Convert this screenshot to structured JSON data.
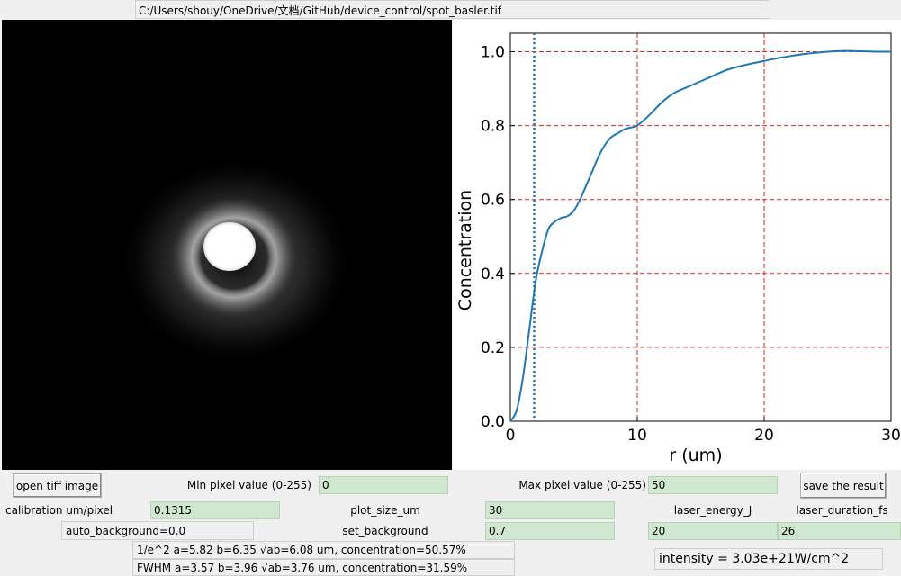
{
  "file_path": "C:/Users/shouy/OneDrive/文档/GitHub/device_control/spot_basler.tif",
  "controls": {
    "open_button": "open tiff image",
    "min_pixel_label": "Min pixel value (0-255)",
    "min_pixel_value": "0",
    "max_pixel_label": "Max pixel value (0-255)",
    "max_pixel_value": "50",
    "save_button": "save the result",
    "calibration_label": "calibration um/pixel",
    "calibration_value": "0.1315",
    "plot_size_label": "plot_size_um",
    "plot_size_value": "30",
    "laser_energy_label": "laser_energy_J",
    "laser_duration_label": "laser_duration_fs",
    "auto_background": "auto_background=0.0",
    "set_background_label": "set_background",
    "set_background_value": "0.7",
    "laser_energy_value": "20",
    "laser_duration_value": "26"
  },
  "results": {
    "e2_line": "1/e^2 a=5.82 b=6.35 √ab=6.08 um, concentration=50.57%",
    "fwhm_line": "FWHM a=3.57 b=3.96 √ab=3.76 um, concentration=31.59%",
    "intensity": "intensity = 3.03e+21W/cm^2"
  },
  "colors": {
    "curve": "#1f77b4",
    "grid": "#d62728",
    "vline": "#1f77b4",
    "input_bg": "#cfe8cf"
  },
  "chart_data": {
    "type": "line",
    "title": "",
    "xlabel": "r (um)",
    "ylabel": "Concentration",
    "xlim": [
      0,
      30
    ],
    "ylim": [
      0,
      1.05
    ],
    "xticks": [
      0,
      10,
      20,
      30
    ],
    "yticks": [
      0.0,
      0.2,
      0.4,
      0.6,
      0.8,
      1.0
    ],
    "grid": true,
    "vertical_marker_x": 1.88,
    "series": [
      {
        "x": [
          0,
          0.5,
          1.0,
          1.5,
          2.0,
          2.5,
          3.0,
          3.5,
          4.0,
          4.5,
          5.0,
          5.5,
          6.0,
          6.5,
          7.0,
          7.5,
          8.0,
          8.5,
          9.0,
          9.5,
          10.0,
          11.0,
          12.0,
          13.0,
          14.0,
          15.0,
          16.0,
          17.0,
          18.0,
          19.0,
          20.0,
          21.0,
          22.0,
          23.0,
          24.0,
          25.0,
          26.0,
          27.0,
          28.0,
          29.0,
          30.0
        ],
        "values": [
          0.0,
          0.03,
          0.12,
          0.25,
          0.38,
          0.46,
          0.52,
          0.54,
          0.55,
          0.555,
          0.57,
          0.6,
          0.64,
          0.68,
          0.72,
          0.75,
          0.77,
          0.78,
          0.79,
          0.795,
          0.8,
          0.83,
          0.865,
          0.89,
          0.905,
          0.92,
          0.935,
          0.95,
          0.96,
          0.968,
          0.975,
          0.982,
          0.988,
          0.993,
          0.997,
          1.0,
          1.002,
          1.002,
          1.001,
          1.0,
          1.0
        ]
      }
    ]
  }
}
